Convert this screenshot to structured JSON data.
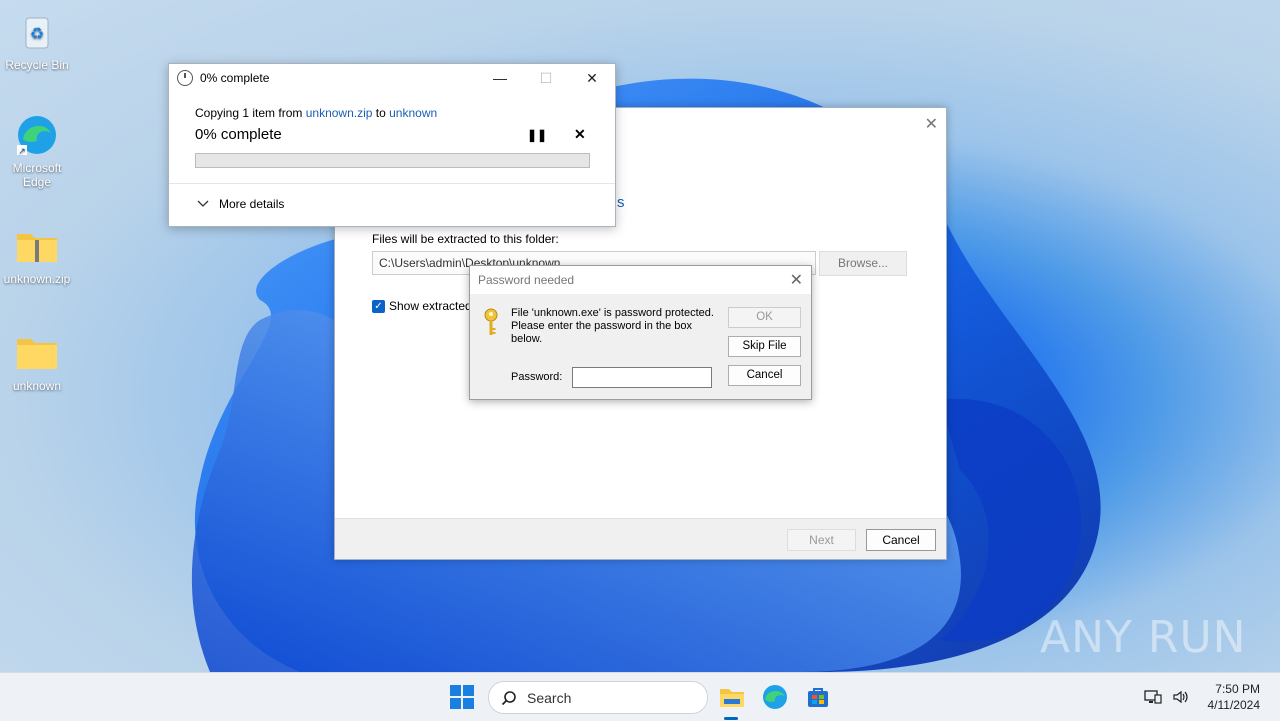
{
  "desktop": {
    "icons": [
      {
        "label": "Recycle Bin"
      },
      {
        "label": "Microsoft Edge"
      },
      {
        "label": "unknown.zip"
      },
      {
        "label": "unknown"
      }
    ]
  },
  "copy_dialog": {
    "title": "0% complete",
    "line_prefix": "Copying 1 item from ",
    "source": "unknown.zip",
    "line_mid": " to ",
    "dest": "unknown",
    "status": "0% complete",
    "progress_percent": 0,
    "more_details": "More details",
    "minimize_glyph": "—",
    "maximize_glyph": "☐",
    "close_glyph": "✕",
    "pause_glyph": "❚❚",
    "stop_glyph": "✕"
  },
  "wizard": {
    "partial_link": "s",
    "dest_label": "Files will be extracted to this folder:",
    "path": "C:\\Users\\admin\\Desktop\\unknown",
    "browse_label": "Browse...",
    "show_label": "Show extracted",
    "next_label": "Next",
    "cancel_label": "Cancel",
    "close_glyph": "✕"
  },
  "password_dialog": {
    "title": "Password needed",
    "message": "File 'unknown.exe' is password protected. Please enter the password in the box below.",
    "password_label": "Password:",
    "password_value": "",
    "ok_label": "OK",
    "skip_label": "Skip File",
    "cancel_label": "Cancel",
    "close_glyph": "✕"
  },
  "watermark": "ANY RUN",
  "taskbar": {
    "search_placeholder": "Search",
    "time": "7:50 PM",
    "date": "4/11/2024"
  },
  "colors": {
    "accent": "#0067c0",
    "link": "#1a5fb4",
    "checkbox": "#0a64c8"
  }
}
